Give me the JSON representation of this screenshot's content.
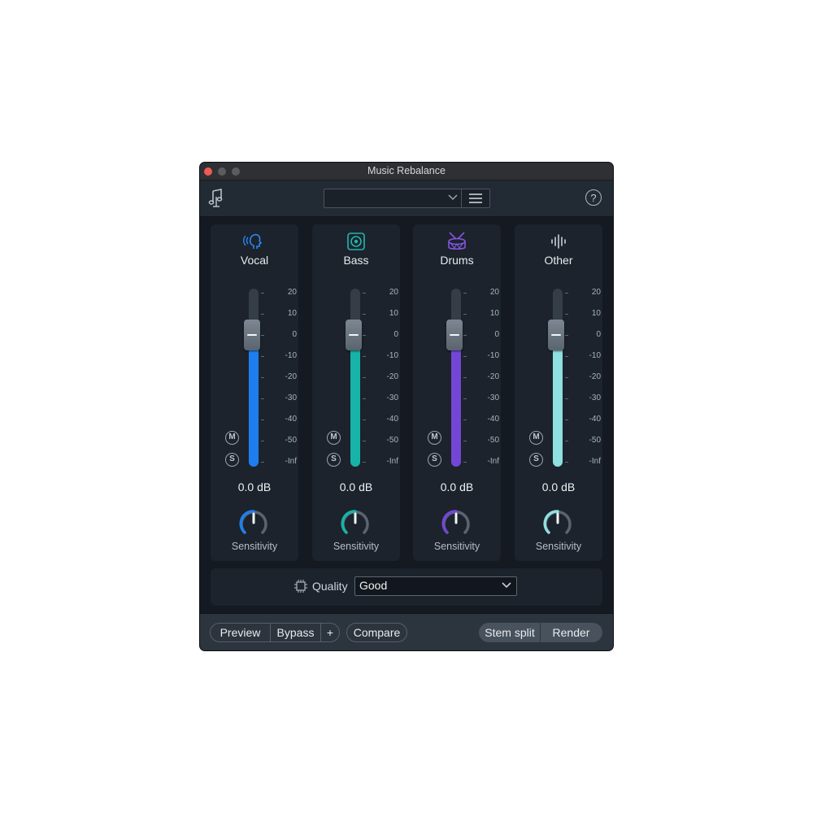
{
  "window": {
    "title": "Music Rebalance"
  },
  "toolbar": {
    "preset_value": ""
  },
  "strips": [
    {
      "name": "Vocal",
      "gain": "0.0 dB",
      "sensitivity_label": "Sensitivity",
      "color": "#1e7ef0",
      "icon": "vocal-head-icon",
      "mute": "M",
      "solo": "S"
    },
    {
      "name": "Bass",
      "gain": "0.0 dB",
      "sensitivity_label": "Sensitivity",
      "color": "#17b3a8",
      "icon": "speaker-icon",
      "mute": "M",
      "solo": "S"
    },
    {
      "name": "Drums",
      "gain": "0.0 dB",
      "sensitivity_label": "Sensitivity",
      "color": "#7346d6",
      "icon": "drum-icon",
      "mute": "M",
      "solo": "S"
    },
    {
      "name": "Other",
      "gain": "0.0 dB",
      "sensitivity_label": "Sensitivity",
      "color": "#8fe0e0",
      "icon": "waveform-icon",
      "mute": "M",
      "solo": "S"
    }
  ],
  "scale": [
    "20",
    "10",
    "0",
    "-10",
    "-20",
    "-30",
    "-40",
    "-50",
    "-Inf"
  ],
  "quality": {
    "label": "Quality",
    "value": "Good"
  },
  "footer": {
    "preview": "Preview",
    "bypass": "Bypass",
    "plus": "+",
    "compare": "Compare",
    "stem_split": "Stem split",
    "render": "Render"
  }
}
